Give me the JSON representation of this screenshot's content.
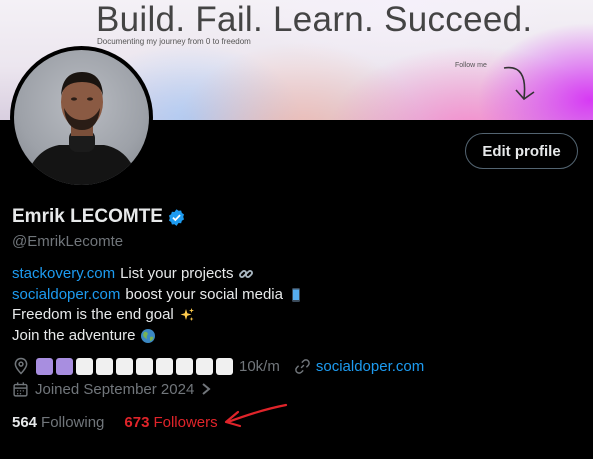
{
  "banner": {
    "title": "Build. Fail. Learn. Succeed.",
    "subtitle": "Documenting my journey from 0 to freedom",
    "follow_me": "Follow me"
  },
  "profile": {
    "name": "Emrik LECOMTE",
    "handle": "@EmrikLecomte",
    "edit_button": "Edit profile",
    "verified_icon": "verified-badge-icon"
  },
  "bio": {
    "line1_link": "stackovery.com",
    "line1_text": "List your projects",
    "line2_link": "socialdoper.com",
    "line2_text": "boost your social media",
    "line3_text": "Freedom is the end goal",
    "line4_text": "Join the adventure"
  },
  "meta": {
    "location_suffix": "10k/m",
    "website": "socialdoper.com",
    "joined": "Joined September 2024"
  },
  "stats": {
    "following_count": "564",
    "following_label": "Following",
    "followers_count": "673",
    "followers_label": "Followers"
  },
  "colors": {
    "accent": "#1d9bf0",
    "muted": "#71767b",
    "highlight_red": "#e0242a"
  }
}
